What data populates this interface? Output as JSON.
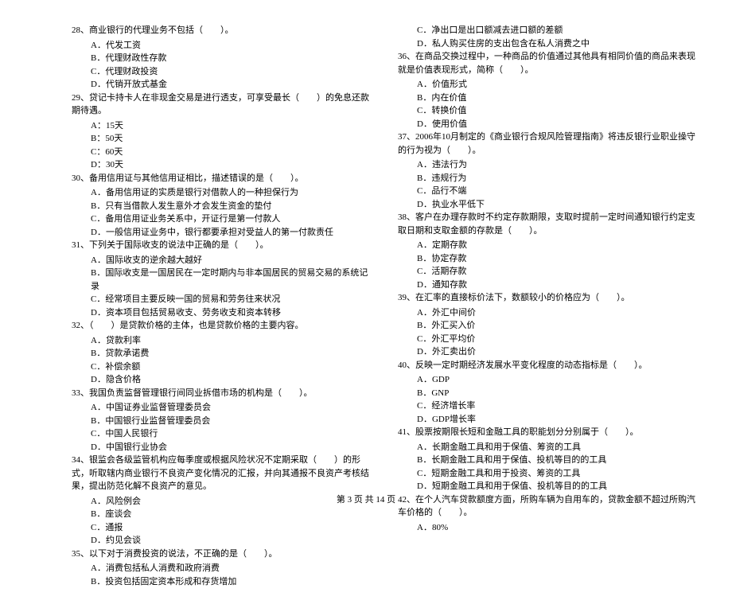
{
  "left": [
    {
      "type": "q",
      "text": "28、商业银行的代理业务不包括（　　）。"
    },
    {
      "type": "opt",
      "text": "A．代发工资"
    },
    {
      "type": "opt",
      "text": "B．代理财政性存款"
    },
    {
      "type": "opt",
      "text": "C．代理财政投资"
    },
    {
      "type": "opt",
      "text": "D．代销开放式基金"
    },
    {
      "type": "q",
      "text": "29、贷记卡持卡人在非现金交易是进行透支，可享受最长（　　）的免息还款期待遇。"
    },
    {
      "type": "opt",
      "text": "A：15天"
    },
    {
      "type": "opt",
      "text": "B：50天"
    },
    {
      "type": "opt",
      "text": "C：60天"
    },
    {
      "type": "opt",
      "text": "D：30天"
    },
    {
      "type": "q",
      "text": "30、备用信用证与其他信用证相比，描述错误的是（　　）。"
    },
    {
      "type": "opt",
      "text": "A．备用信用证的实质是银行对借款人的一种担保行为"
    },
    {
      "type": "opt",
      "text": "B．只有当借款人发生意外才会发生资金的垫付"
    },
    {
      "type": "opt",
      "text": "C．备用信用证业务关系中，开证行是第一付款人"
    },
    {
      "type": "opt",
      "text": "D．一般信用证业务中，银行都要承担对受益人的第一付款责任"
    },
    {
      "type": "q",
      "text": "31、下列关于国际收支的说法中正确的是（　　）。"
    },
    {
      "type": "opt",
      "text": "A．国际收支的逆余越大越好"
    },
    {
      "type": "opt",
      "text": "B．国际收支是一国居民在一定时期内与非本国居民的贸易交易的系统记录"
    },
    {
      "type": "opt",
      "text": "C．经常项目主要反映一国的贸易和劳务往来状况"
    },
    {
      "type": "opt",
      "text": "D．资本项目包括贸易收支、劳务收支和资本转移"
    },
    {
      "type": "q",
      "text": "32、（　　）是贷款价格的主体，也是贷款价格的主要内容。"
    },
    {
      "type": "opt",
      "text": "A．贷款利率"
    },
    {
      "type": "opt",
      "text": "B．贷款承诺费"
    },
    {
      "type": "opt",
      "text": "C．补偿余额"
    },
    {
      "type": "opt",
      "text": "D．隐含价格"
    },
    {
      "type": "q",
      "text": "33、我国负责监督管理银行间同业拆借市场的机构是（　　）。"
    },
    {
      "type": "opt",
      "text": "A．中国证券业监督管理委员会"
    },
    {
      "type": "opt",
      "text": "B．中国银行业监督管理委员会"
    },
    {
      "type": "opt",
      "text": "C．中国人民银行"
    },
    {
      "type": "opt",
      "text": "D．中国银行业协会"
    },
    {
      "type": "q",
      "text": "34、银监会各级监管机构应每季度或根据风险状况不定期采取（　　）的形式，听取辖内商业银行不良资产变化情况的汇报，并向其通报不良资产考核结果，提出防范化解不良资产的意见。"
    },
    {
      "type": "opt",
      "text": "A．风险例会"
    },
    {
      "type": "opt",
      "text": "B．座谈会"
    },
    {
      "type": "opt",
      "text": "C．通报"
    },
    {
      "type": "opt",
      "text": "D．约见会谈"
    },
    {
      "type": "q",
      "text": "35、以下对于消费投资的说法，不正确的是（　　）。"
    },
    {
      "type": "opt",
      "text": "A．消费包括私人消费和政府消费"
    },
    {
      "type": "opt",
      "text": "B．投资包括固定资本形成和存货增加"
    }
  ],
  "right": [
    {
      "type": "opt",
      "text": "C．净出口是出口额减去进口额的差额"
    },
    {
      "type": "opt",
      "text": "D．私人购买住房的支出包含在私人消费之中"
    },
    {
      "type": "q",
      "text": "36、在商品交换过程中，一种商品的价值通过其他具有相同价值的商品来表现就是价值表现形式，简称（　　）。"
    },
    {
      "type": "opt",
      "text": "A．价值形式"
    },
    {
      "type": "opt",
      "text": "B．内在价值"
    },
    {
      "type": "opt",
      "text": "C．转换价值"
    },
    {
      "type": "opt",
      "text": "D．使用价值"
    },
    {
      "type": "q",
      "text": "37、2006年10月制定的《商业银行合规风险管理指南》将违反银行业职业操守的行为视为（　　）。"
    },
    {
      "type": "opt",
      "text": "A．违法行为"
    },
    {
      "type": "opt",
      "text": "B．违规行为"
    },
    {
      "type": "opt",
      "text": "C．品行不端"
    },
    {
      "type": "opt",
      "text": "D．执业水平低下"
    },
    {
      "type": "q",
      "text": "38、客户在办理存款时不约定存款期限，支取时提前一定时间通知银行约定支取日期和支取金额的存款是（　　）。"
    },
    {
      "type": "opt",
      "text": "A．定期存款"
    },
    {
      "type": "opt",
      "text": "B．协定存款"
    },
    {
      "type": "opt",
      "text": "C．活期存款"
    },
    {
      "type": "opt",
      "text": "D．通知存款"
    },
    {
      "type": "q",
      "text": "39、在汇率的直接标价法下，数额较小的价格应为（　　）。"
    },
    {
      "type": "opt",
      "text": "A．外汇中间价"
    },
    {
      "type": "opt",
      "text": "B．外汇买入价"
    },
    {
      "type": "opt",
      "text": "C．外汇平均价"
    },
    {
      "type": "opt",
      "text": "D．外汇卖出价"
    },
    {
      "type": "q",
      "text": "40、反映一定时期经济发展水平变化程度的动态指标是（　　）。"
    },
    {
      "type": "opt",
      "text": "A．GDP"
    },
    {
      "type": "opt",
      "text": "B．GNP"
    },
    {
      "type": "opt",
      "text": "C．经济增长率"
    },
    {
      "type": "opt",
      "text": "D．GDP增长率"
    },
    {
      "type": "q",
      "text": "41、股票按期限长短和金融工具的职能划分分别属于（　　）。"
    },
    {
      "type": "opt",
      "text": "A．长期金融工具和用于保值、筹资的工具"
    },
    {
      "type": "opt",
      "text": "B．长期金融工具和用于保值、投机等目的的工具"
    },
    {
      "type": "opt",
      "text": "C．短期金融工具和用于投资、筹资的工具"
    },
    {
      "type": "opt",
      "text": "D．短期金融工具和用于保值、投机等目的的工具"
    },
    {
      "type": "q",
      "text": "42、在个人汽车贷款额度方面，所购车辆为自用车的，贷款金额不超过所购汽车价格的（　　）。"
    },
    {
      "type": "opt",
      "text": "A．80%"
    }
  ],
  "footer": "第 3 页 共 14 页"
}
